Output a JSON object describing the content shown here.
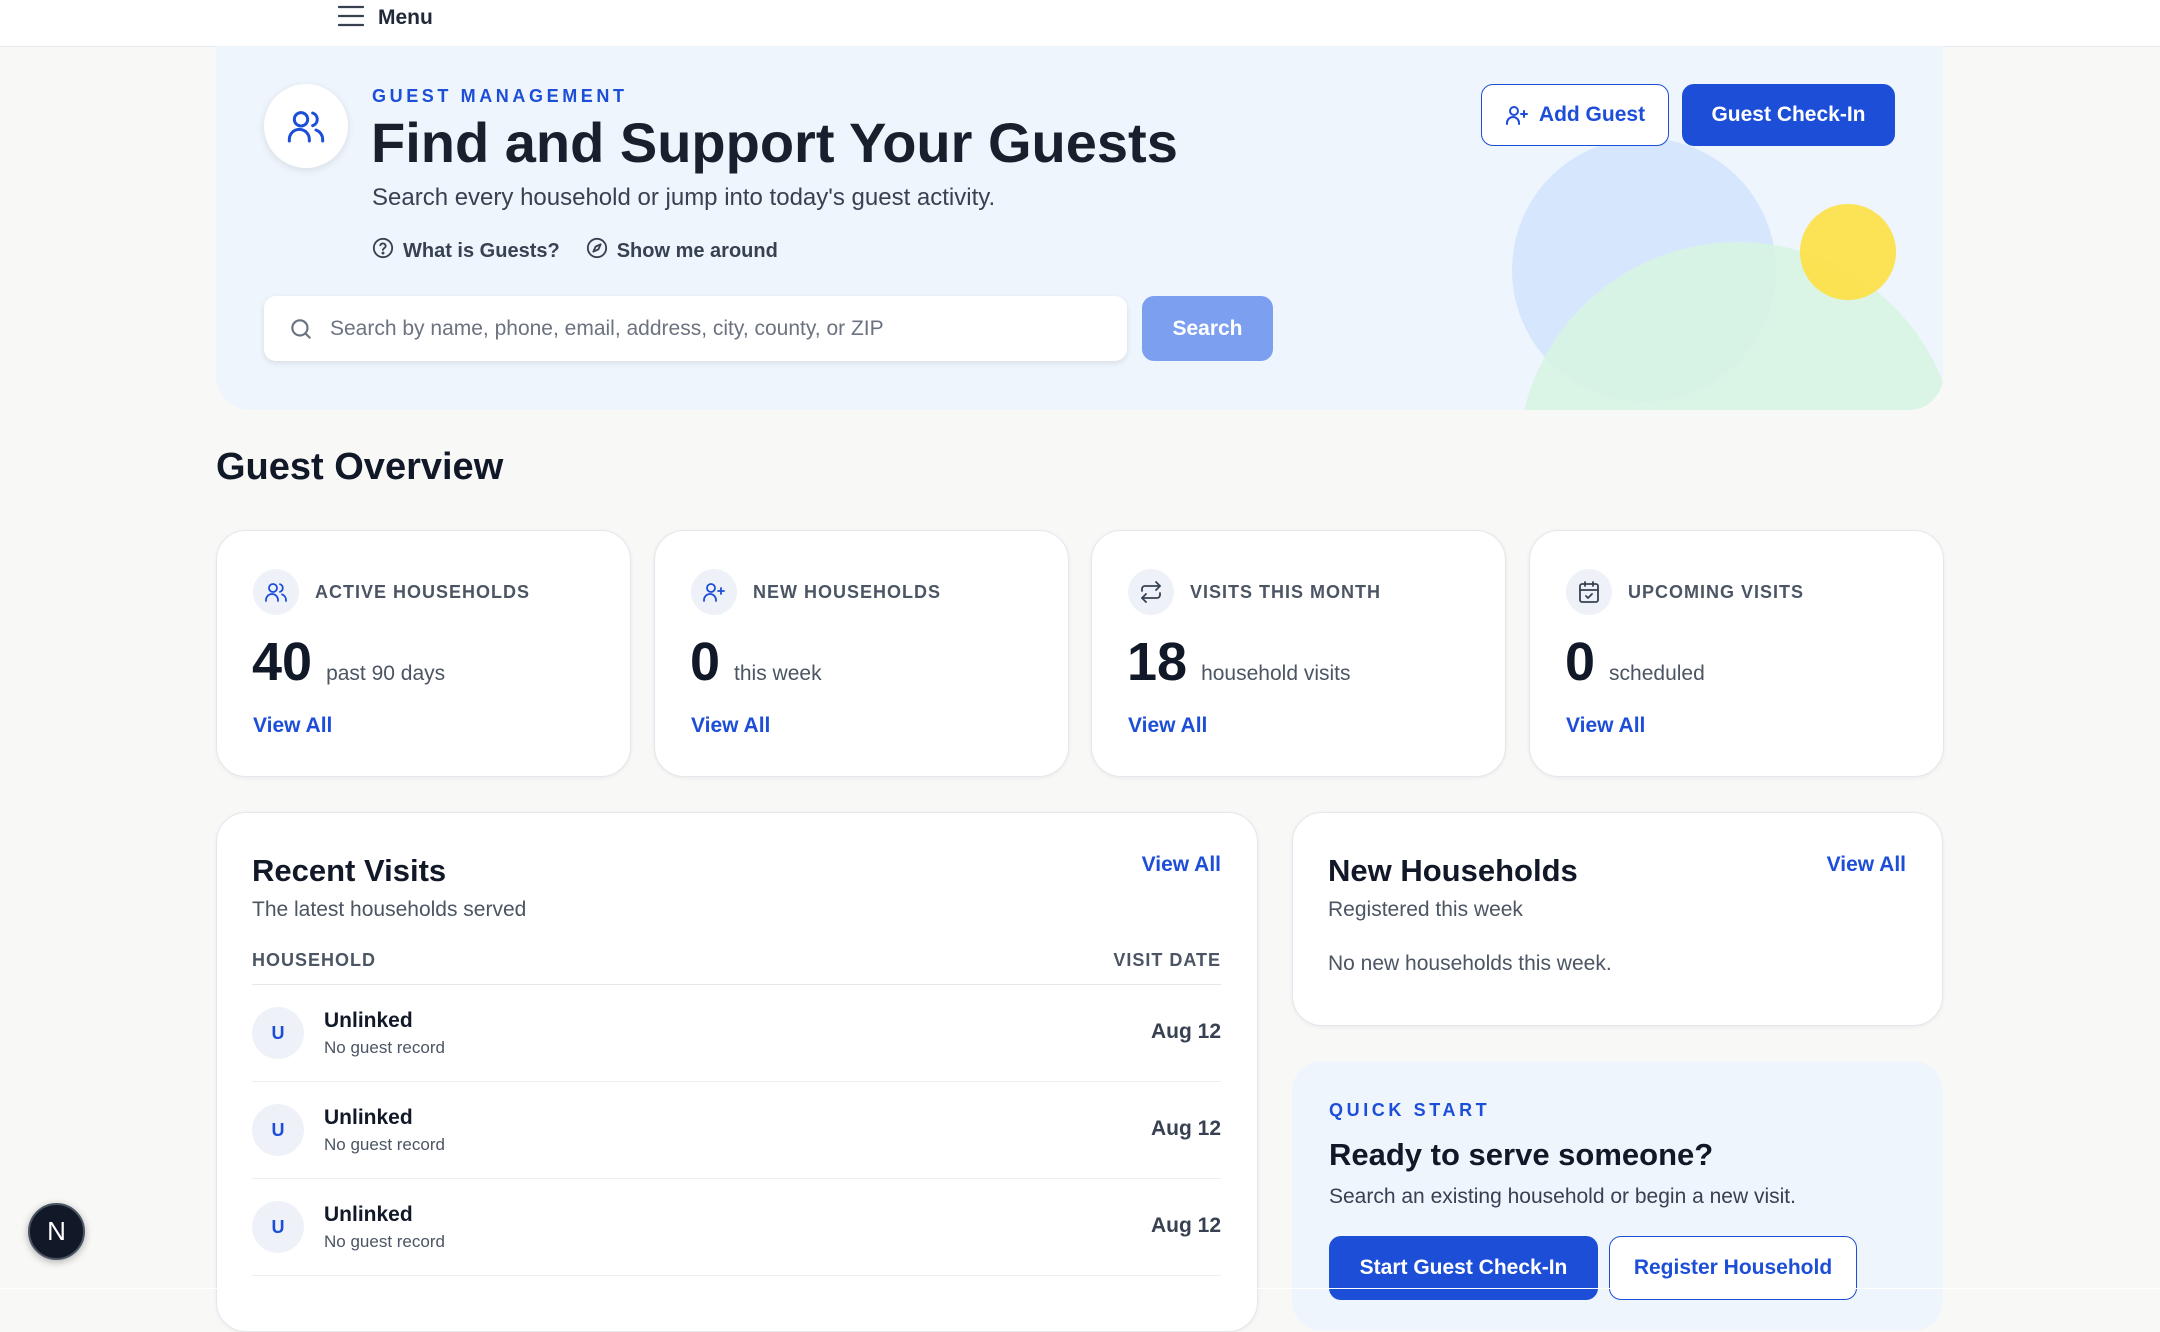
{
  "topbar": {
    "menu_label": "Menu",
    "menu_icon": "hamburger-icon"
  },
  "hero": {
    "eyebrow": "GUEST MANAGEMENT",
    "title": "Find and Support Your Guests",
    "subtitle": "Search every household or jump into today's guest activity.",
    "icon": "users-icon",
    "links": [
      {
        "label": "What is Guests?",
        "icon": "help-circle-icon"
      },
      {
        "label": "Show me around",
        "icon": "compass-icon"
      }
    ],
    "search": {
      "placeholder": "Search by name, phone, email, address, city, county, or ZIP",
      "value": "",
      "button_label": "Search"
    },
    "add_guest_label": "Add Guest",
    "checkin_label": "Guest Check-In"
  },
  "overview": {
    "title": "Guest Overview",
    "stats": [
      {
        "label": "ACTIVE HOUSEHOLDS",
        "value": "40",
        "unit": "past 90 days",
        "link": "View All",
        "icon": "users-icon"
      },
      {
        "label": "NEW HOUSEHOLDS",
        "value": "0",
        "unit": "this week",
        "link": "View All",
        "icon": "user-plus-icon"
      },
      {
        "label": "VISITS THIS MONTH",
        "value": "18",
        "unit": "household visits",
        "link": "View All",
        "icon": "repeat-icon"
      },
      {
        "label": "UPCOMING VISITS",
        "value": "0",
        "unit": "scheduled",
        "link": "View All",
        "icon": "calendar-check-icon"
      }
    ]
  },
  "recent_visits": {
    "title": "Recent Visits",
    "subtitle": "The latest households served",
    "view_all": "View All",
    "columns": [
      "HOUSEHOLD",
      "VISIT DATE"
    ],
    "rows": [
      {
        "initial": "U",
        "name": "Unlinked",
        "sub": "No guest record",
        "date": "Aug 12"
      },
      {
        "initial": "U",
        "name": "Unlinked",
        "sub": "No guest record",
        "date": "Aug 12"
      },
      {
        "initial": "U",
        "name": "Unlinked",
        "sub": "No guest record",
        "date": "Aug 12"
      }
    ]
  },
  "new_households": {
    "title": "New Households",
    "subtitle": "Registered this week",
    "view_all": "View All",
    "empty_text": "No new households this week."
  },
  "quick_start": {
    "eyebrow": "QUICK START",
    "title": "Ready to serve someone?",
    "subtitle": "Search an existing household or begin a new visit.",
    "primary_label": "Start Guest Check-In",
    "secondary_label": "Register Household"
  },
  "dev_badge": {
    "label": "N"
  },
  "colors": {
    "accent": "#1d4ed8",
    "hero_bg": "#eef5fd",
    "page_bg": "#f8f8f7",
    "yellow": "#fde047"
  }
}
